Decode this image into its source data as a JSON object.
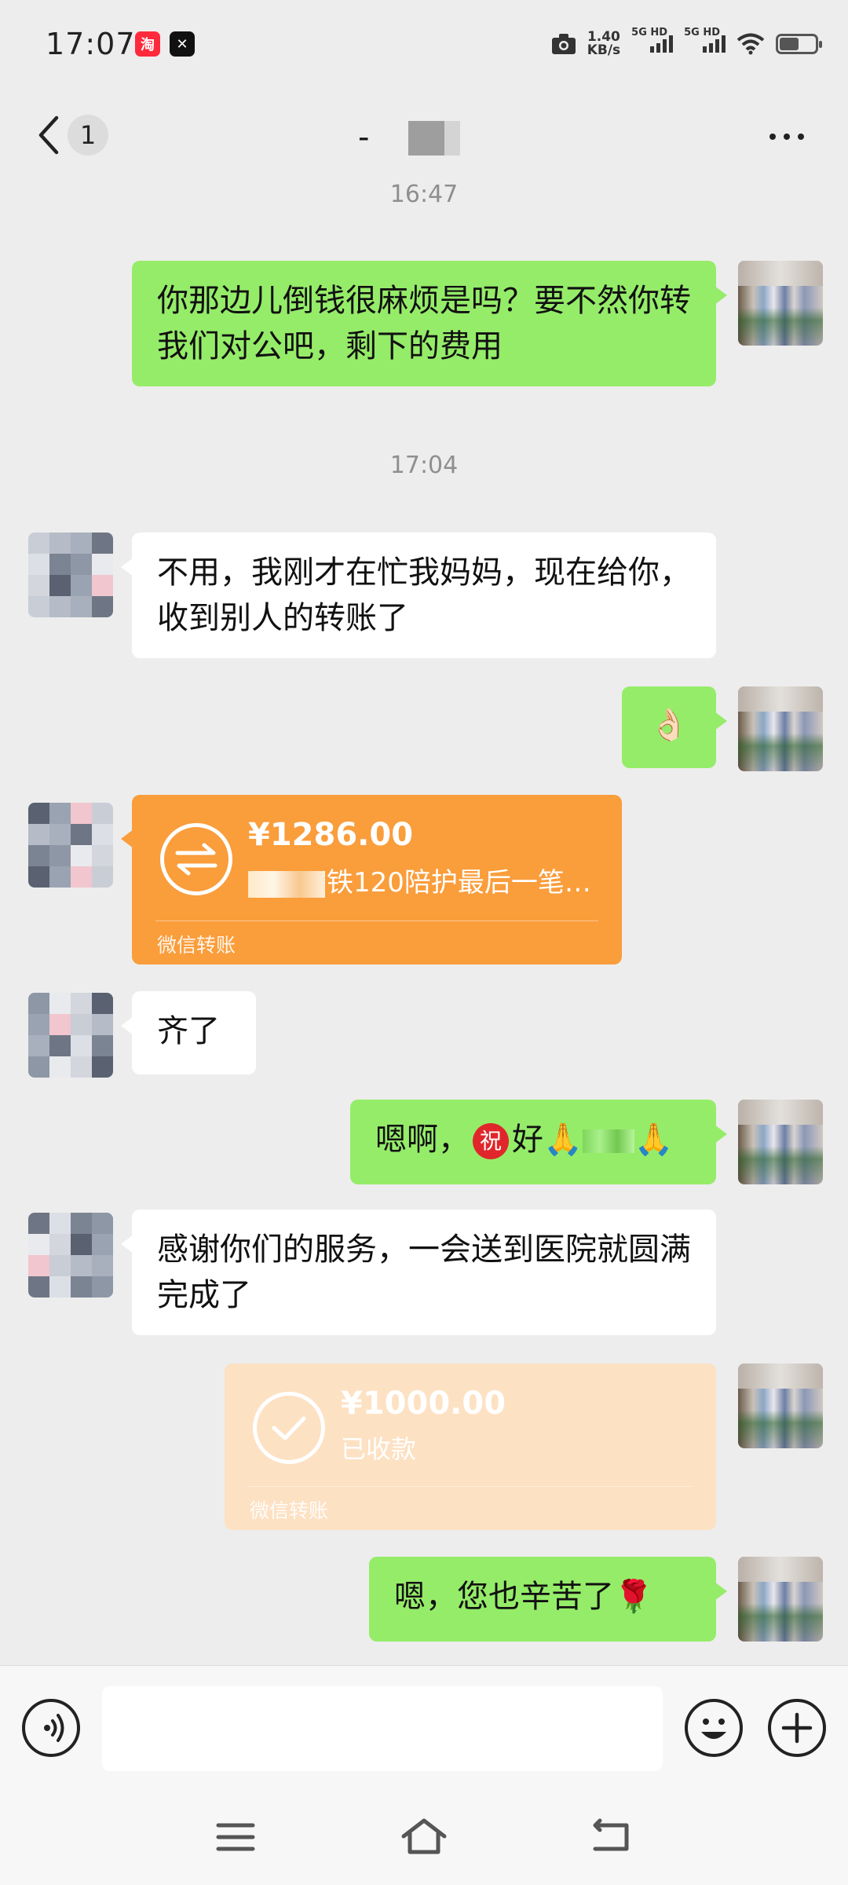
{
  "status_bar": {
    "time": "17:07",
    "net_speed_value": "1.40",
    "net_speed_unit": "KB/s",
    "sim1": "5G HD",
    "sim2": "5G HD",
    "battery_level": 0.55,
    "app_icons": [
      "taobao-icon",
      "capcut-icon"
    ]
  },
  "header": {
    "unread_count": "1",
    "title": "-"
  },
  "messages": {
    "ts1": "16:47",
    "m1": "你那边儿倒钱很麻烦是吗？要不然你转我们对公吧，剩下的费用",
    "ts2": "17:04",
    "m2": "不用，我刚才在忙我妈妈，现在给你，收到别人的转账了",
    "m3": "👌🏻",
    "transfer1": {
      "amount": "¥1286.00",
      "note": "铁120陪护最后一笔…",
      "label": "微信转账"
    },
    "m4": "齐了",
    "m5_prefix": "嗯啊，",
    "m5_zhu": "祝",
    "m5_suffix": "好🙏",
    "m5_end": "🙏",
    "m6": "感谢你们的服务，一会送到医院就圆满完成了",
    "transfer2": {
      "amount": "¥1000.00",
      "status": "已收款",
      "label": "微信转账"
    },
    "m7": "嗯，您也辛苦了🌹"
  },
  "input": {
    "placeholder": ""
  },
  "colors": {
    "self_bubble": "#95ec69",
    "other_bubble": "#ffffff",
    "transfer_orange": "#fa9d3b",
    "transfer_received": "#fde1c3",
    "background": "#ededed"
  }
}
